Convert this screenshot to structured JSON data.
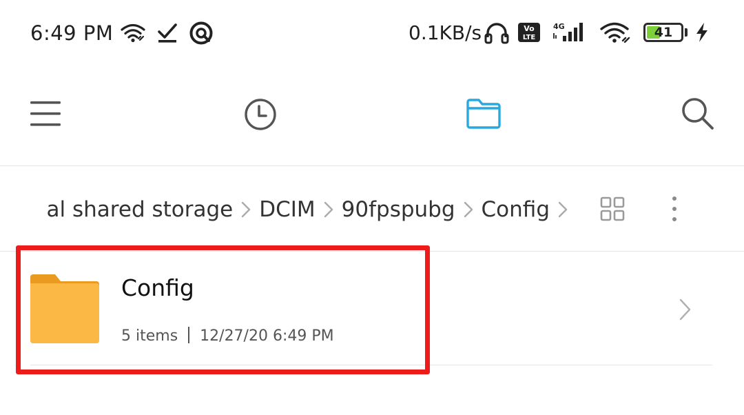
{
  "status_bar": {
    "time": "6:49 PM",
    "network_speed": "0.1KB/s",
    "battery_level": "41",
    "battery_percent": 41,
    "icons": [
      "wifi-icon",
      "download-done-icon",
      "app-notification-icon",
      "headset-icon",
      "volte-icon",
      "signal-4g-icon",
      "wifi-icon",
      "battery-icon",
      "charging-icon"
    ],
    "volte_label": "Vo\nLTE",
    "network_type": "4G"
  },
  "toolbar": {
    "buttons": [
      {
        "name": "menu",
        "icon": "hamburger-menu-icon"
      },
      {
        "name": "recent",
        "icon": "clock-icon"
      },
      {
        "name": "files",
        "icon": "folder-icon",
        "active": true
      },
      {
        "name": "search",
        "icon": "search-icon"
      }
    ],
    "active_color": "#29a8e0",
    "icon_color": "#555555"
  },
  "breadcrumb": {
    "items": [
      {
        "label": "al shared storage"
      },
      {
        "label": "DCIM"
      },
      {
        "label": "90fpspubg"
      },
      {
        "label": "Config"
      }
    ],
    "separator_icon": "chevron-right-icon",
    "view_toggle_icon": "grid-view-icon",
    "more_icon": "more-vertical-icon"
  },
  "file_list": {
    "items": [
      {
        "name": "Config",
        "item_count": "5 items",
        "modified": "12/27/20 6:49 PM",
        "icon": "folder-icon",
        "folder_color": "#fbb845",
        "folder_tab_color": "#e99a1f"
      }
    ]
  },
  "annotation": {
    "highlight_color": "#ee1b1b"
  }
}
